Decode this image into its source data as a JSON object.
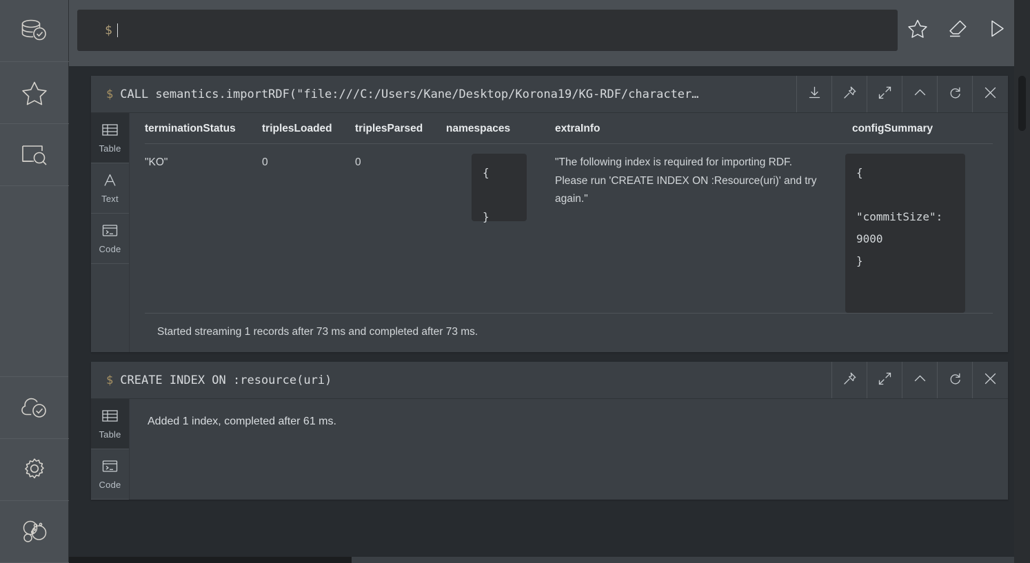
{
  "colors": {
    "sidebar_bg": "#4a4f54",
    "frame_bg": "#3b4045",
    "page_bg": "#272b2f",
    "input_bg": "#2e3033",
    "text": "#d3d7da",
    "prompt_accent": "#a89263"
  },
  "sidebar": {
    "items": [
      {
        "icon": "database-check-icon",
        "name": "sidebar-item-database"
      },
      {
        "icon": "star-icon",
        "name": "sidebar-item-favorites"
      },
      {
        "icon": "project-files-icon",
        "name": "sidebar-item-project-files"
      },
      {
        "icon": "cloud-check-icon",
        "name": "sidebar-item-cloud"
      },
      {
        "icon": "gear-icon",
        "name": "sidebar-item-settings"
      },
      {
        "icon": "about-bubbles-icon",
        "name": "sidebar-item-about"
      }
    ]
  },
  "editor": {
    "prompt": "$",
    "value": "",
    "placeholder": "",
    "actions": [
      {
        "label": "Favorite",
        "icon": "star-icon"
      },
      {
        "label": "Clear",
        "icon": "eraser-icon"
      },
      {
        "label": "Run",
        "icon": "play-icon"
      }
    ]
  },
  "frames": [
    {
      "prompt": "$",
      "command": "CALL semantics.importRDF(\"file:///C:/Users/Kane/Desktop/Korona19/KG-RDF/character…",
      "header_buttons": [
        {
          "name": "download-icon",
          "label": "Download"
        },
        {
          "name": "pin-icon",
          "label": "Pin"
        },
        {
          "name": "expand-icon",
          "label": "Expand"
        },
        {
          "name": "collapse-icon",
          "label": "Collapse"
        },
        {
          "name": "rerun-icon",
          "label": "Rerun"
        },
        {
          "name": "close-icon",
          "label": "Close"
        }
      ],
      "view_tabs": [
        {
          "label": "Table",
          "icon": "table-icon",
          "active": true
        },
        {
          "label": "Text",
          "icon": "text-icon",
          "active": false
        },
        {
          "label": "Code",
          "icon": "code-icon",
          "active": false
        }
      ],
      "table": {
        "columns": [
          "terminationStatus",
          "triplesLoaded",
          "triplesParsed",
          "namespaces",
          "extraInfo",
          "configSummary"
        ],
        "row": {
          "terminationStatus": "\"KO\"",
          "triplesLoaded": "0",
          "triplesParsed": "0",
          "namespaces": "{\n\n}",
          "extraInfo": "\"The following index is required for importing RDF. Please run 'CREATE INDEX ON :Resource(uri)' and try again.\"",
          "configSummary": "{\n\n\"commitSize\": 9000\n}"
        }
      },
      "status": "Started streaming 1 records after 73 ms and completed after 73 ms."
    },
    {
      "prompt": "$",
      "command": "CREATE INDEX ON :resource(uri)",
      "header_buttons": [
        {
          "name": "pin-icon",
          "label": "Pin"
        },
        {
          "name": "expand-icon",
          "label": "Expand"
        },
        {
          "name": "collapse-icon",
          "label": "Collapse"
        },
        {
          "name": "rerun-icon",
          "label": "Rerun"
        },
        {
          "name": "close-icon",
          "label": "Close"
        }
      ],
      "view_tabs": [
        {
          "label": "Table",
          "icon": "table-icon",
          "active": true
        },
        {
          "label": "Code",
          "icon": "code-icon",
          "active": false
        }
      ],
      "result": "Added 1 index, completed after 61 ms."
    }
  ]
}
